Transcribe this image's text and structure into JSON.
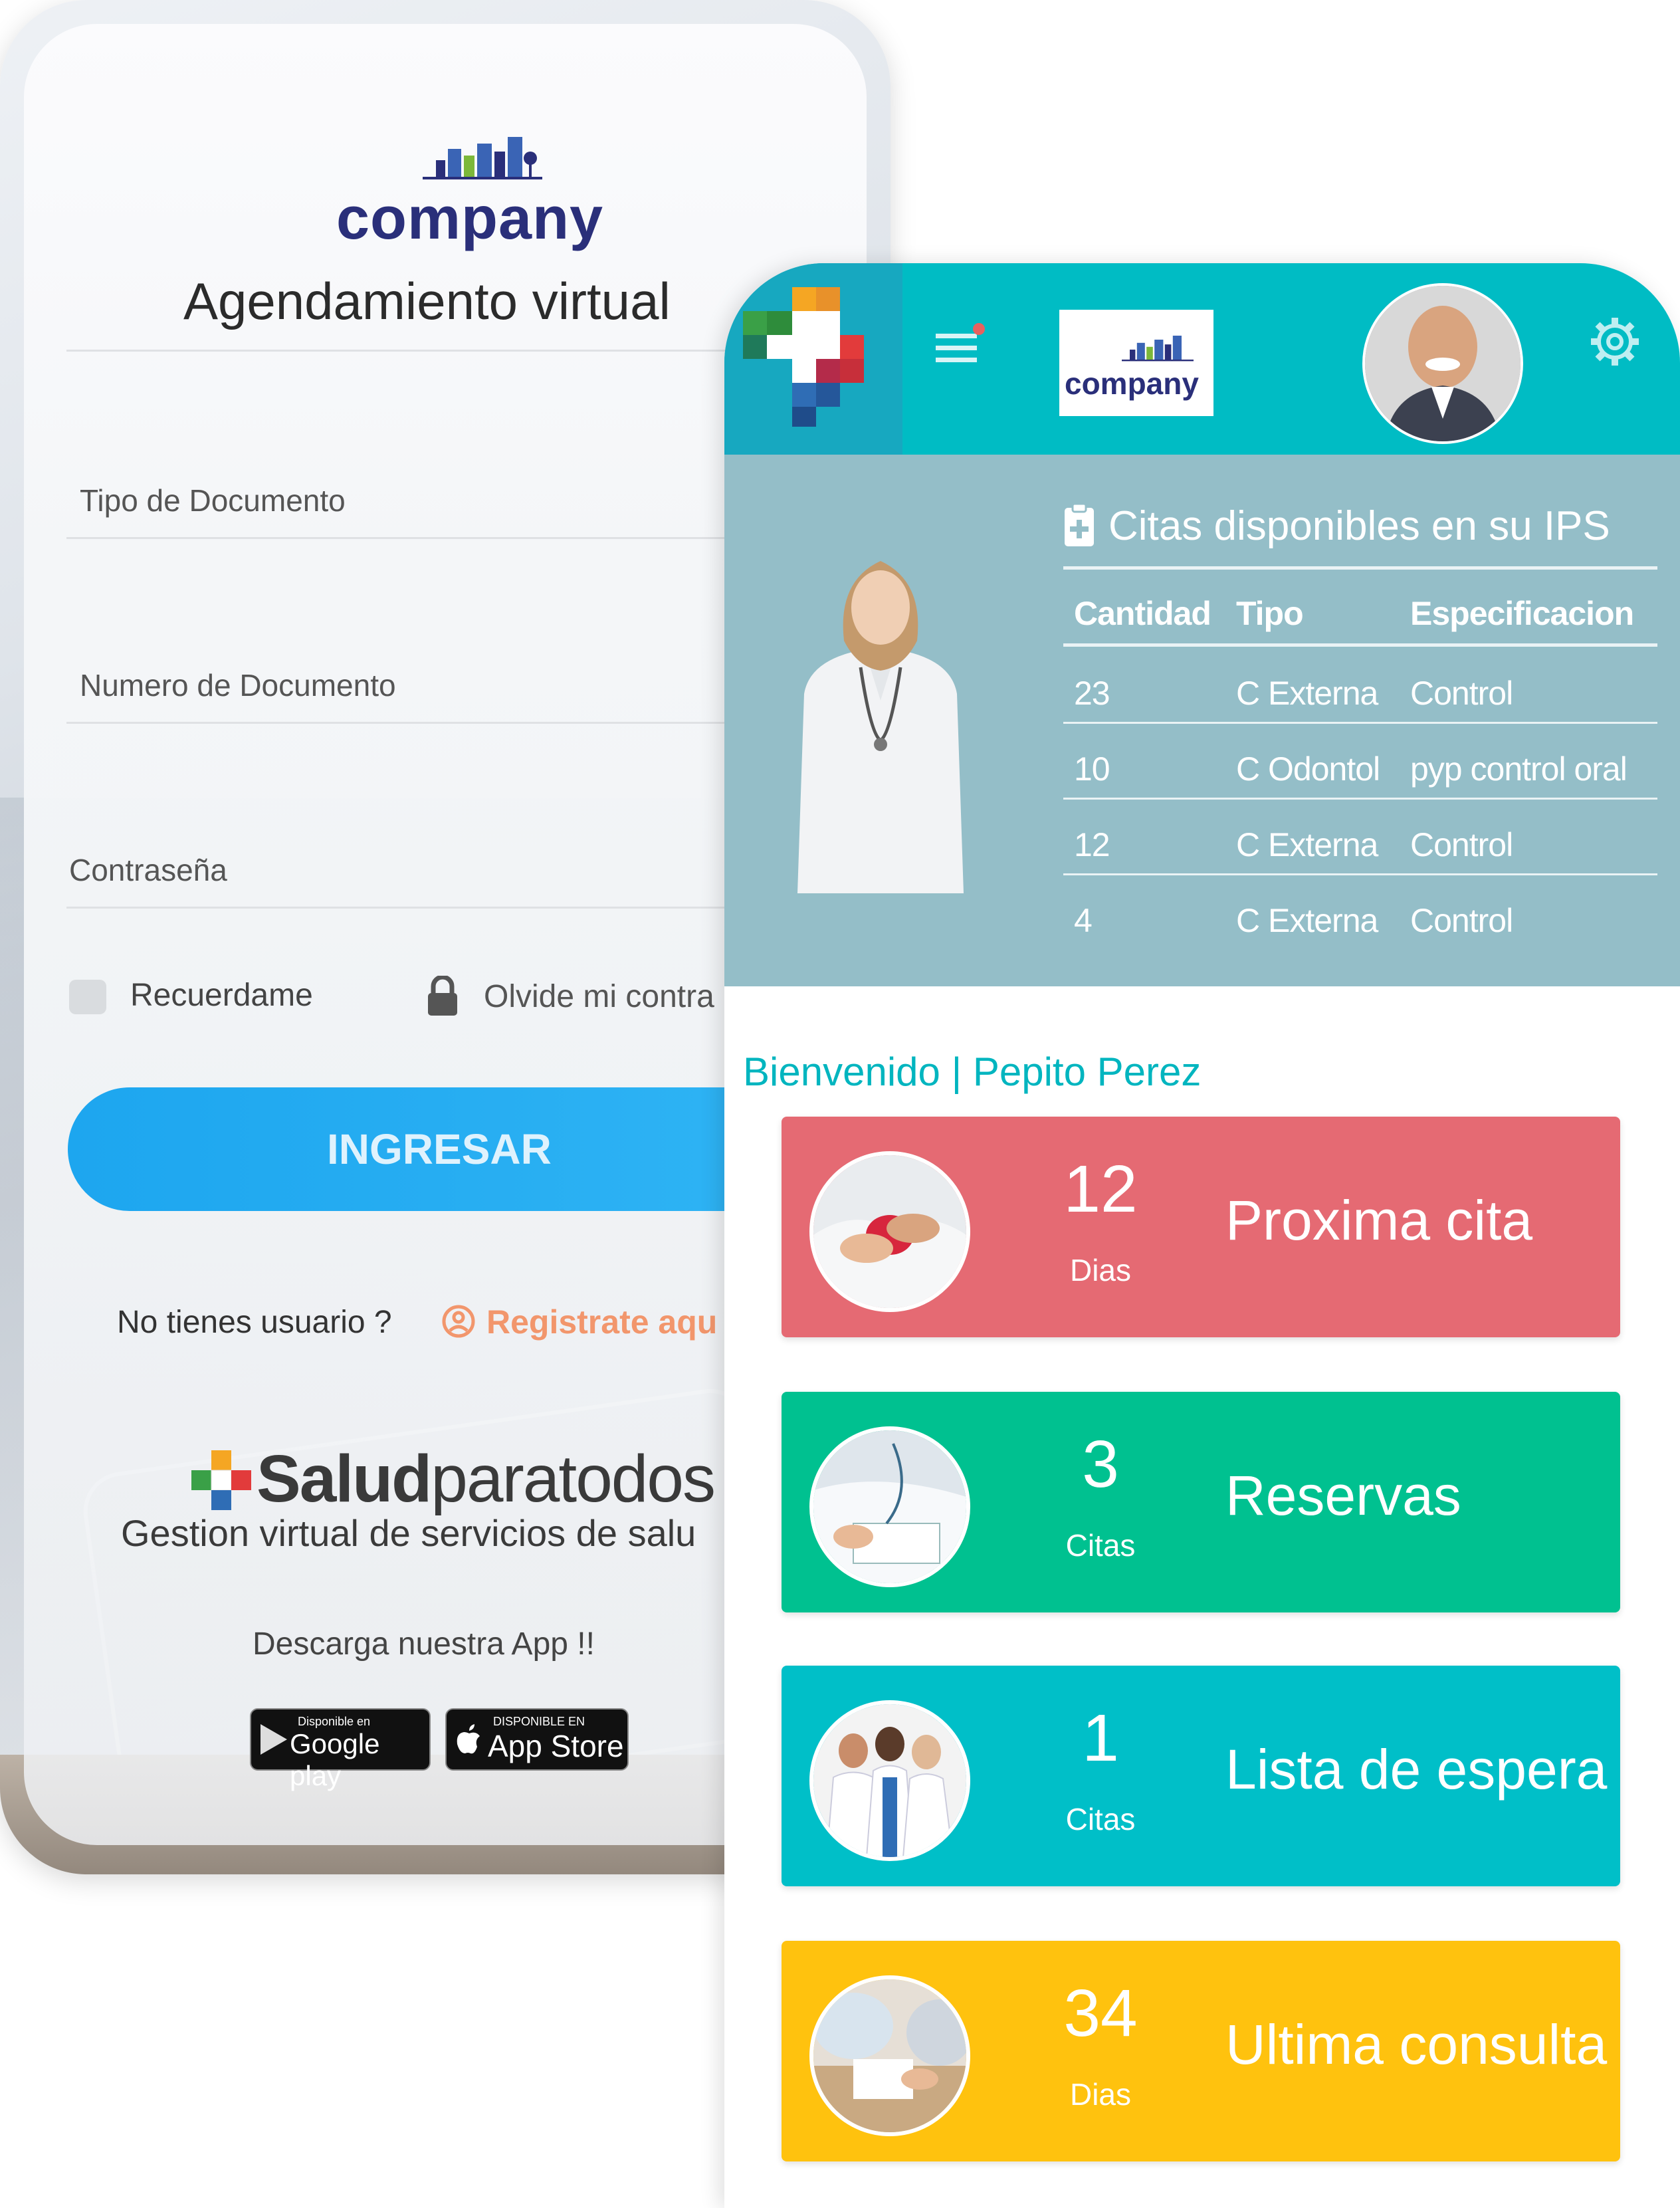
{
  "login": {
    "brand": "company",
    "title": "Agendamiento virtual",
    "fields": {
      "doc_type": "Tipo de Documento",
      "doc_number": "Numero de Documento",
      "password": "Contraseña"
    },
    "remember_label": "Recuerdame",
    "forgot_label": "Olvide mi contra",
    "submit_label": "INGRESAR",
    "no_user_text": "No tienes usuario ?",
    "register_label": "Registrate aqu",
    "footer_brand_bold": "Salud",
    "footer_brand_rest": "paratodos",
    "footer_subtitle": "Gestion virtual de servicios de salu",
    "download_text": "Descarga nuestra App !!",
    "google_play": {
      "small": "Disponible en",
      "big": "Google play"
    },
    "app_store": {
      "small": "DISPONIBLE EN",
      "big": "App Store"
    }
  },
  "dashboard": {
    "brand": "company",
    "ips": {
      "title": "Citas disponibles en su IPS",
      "columns": [
        "Cantidad",
        "Tipo",
        "Especificacion"
      ],
      "rows": [
        [
          "23",
          "C Externa",
          "Control"
        ],
        [
          "10",
          "C Odontol",
          "pyp control oral"
        ],
        [
          "12",
          "C Externa",
          "Control"
        ],
        [
          "4",
          "C Externa",
          "Control"
        ]
      ]
    },
    "welcome": "Bienvenido | Pepito Perez",
    "cards": [
      {
        "value": "12",
        "unit": "Dias",
        "label": "Proxima cita",
        "color": "#e56a73"
      },
      {
        "value": "3",
        "unit": "Citas",
        "label": "Reservas",
        "color": "#00c190"
      },
      {
        "value": "1",
        "unit": "Citas",
        "label": "Lista de espera",
        "color": "#00bfc8"
      },
      {
        "value": "34",
        "unit": "Dias",
        "label": "Ultima consulta",
        "color": "#ffc20e"
      }
    ]
  },
  "colors": {
    "header": "#00bcc4",
    "ips_panel": "#94bec8",
    "accent": "#1da6ef",
    "register": "#f2966c"
  }
}
